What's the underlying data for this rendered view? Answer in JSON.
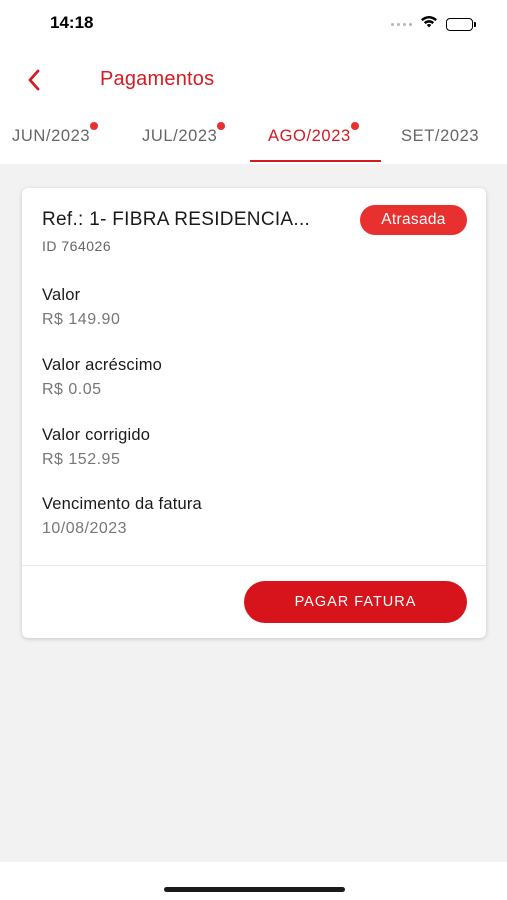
{
  "status_bar": {
    "time": "14:18"
  },
  "header": {
    "title": "Pagamentos"
  },
  "tabs": [
    {
      "label": "JUN/2023",
      "has_dot": true,
      "active": false
    },
    {
      "label": "JUL/2023",
      "has_dot": true,
      "active": false
    },
    {
      "label": "AGO/2023",
      "has_dot": true,
      "active": true
    },
    {
      "label": "SET/2023",
      "has_dot": false,
      "active": false
    }
  ],
  "invoice": {
    "ref": "Ref.: 1- FIBRA RESIDENCIA...",
    "id": "ID 764026",
    "status": "Atrasada",
    "fields": [
      {
        "label": "Valor",
        "value": "R$ 149.90"
      },
      {
        "label": "Valor acréscimo",
        "value": "R$ 0.05"
      },
      {
        "label": "Valor corrigido",
        "value": "R$ 152.95"
      },
      {
        "label": "Vencimento da fatura",
        "value": "10/08/2023"
      }
    ],
    "pay_button_label": "PAGAR FATURA"
  },
  "colors": {
    "brand_red": "#d71920",
    "badge_red": "#e8302f",
    "background": "#f2f2f2"
  },
  "icons": {
    "back": "chevron-left-icon",
    "signal": "cellular-signal-icon",
    "wifi": "wifi-icon",
    "battery": "battery-icon"
  }
}
